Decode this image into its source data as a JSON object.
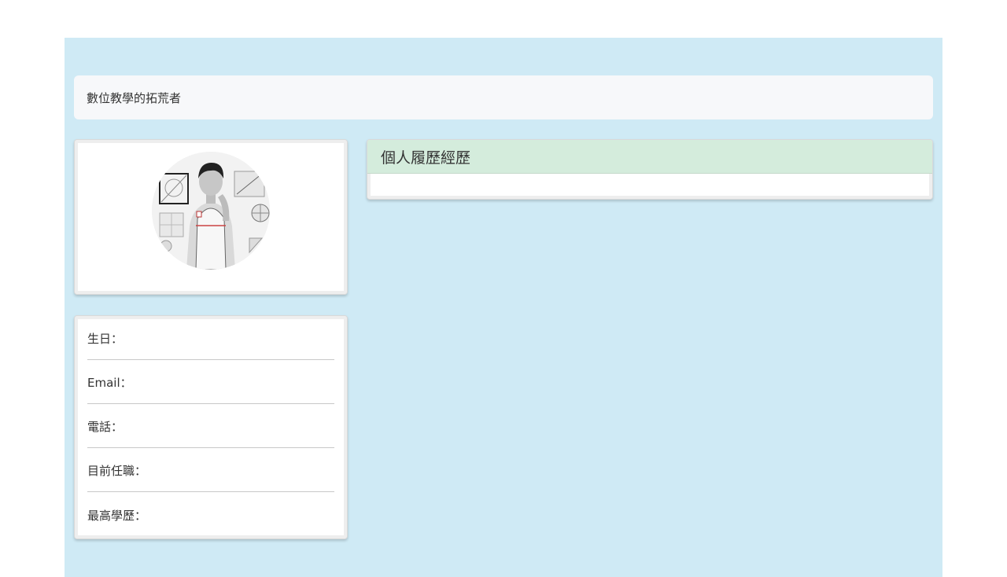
{
  "navbar": {
    "title": "數位教學的拓荒者"
  },
  "profile": {
    "photo_label": "profile-photo"
  },
  "info": {
    "items": [
      {
        "label": "生日："
      },
      {
        "label": "Email："
      },
      {
        "label": "電話："
      },
      {
        "label": "目前任職："
      },
      {
        "label": "最高學歷："
      }
    ]
  },
  "resume": {
    "header": "個人履歷經歷"
  },
  "colors": {
    "page_background": "#cfeaf5",
    "navbar_background": "#f7f8fa",
    "resume_header_background": "#d4ecdc"
  }
}
